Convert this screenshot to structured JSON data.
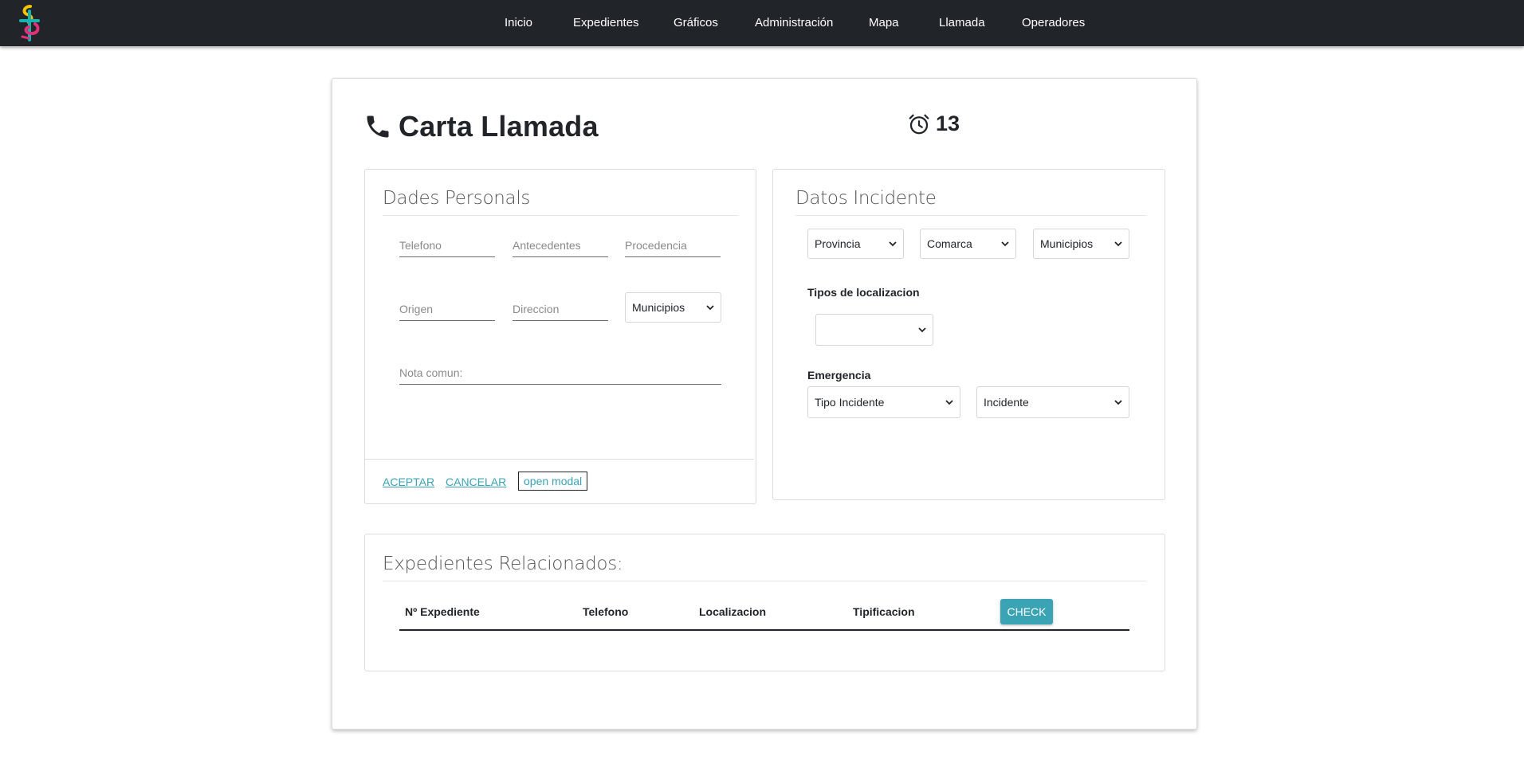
{
  "nav": {
    "items": [
      "Inicio",
      "Expedientes",
      "Gráficos",
      "Administración",
      "Mapa",
      "Llamada",
      "Operadores"
    ]
  },
  "header": {
    "title": "Carta Llamada",
    "timer_value": "13"
  },
  "personal": {
    "title": "Dades Personals",
    "telefono_placeholder": "Telefono",
    "antecedentes_placeholder": "Antecedentes",
    "procedencia_placeholder": "Procedencia",
    "origen_placeholder": "Origen",
    "direccion_placeholder": "Direccion",
    "municipios_select": "Municipios",
    "nota_placeholder": "Nota comun:",
    "aceptar_label": "ACEPTAR",
    "cancelar_label": "CANCELAR",
    "open_modal_label": "open modal"
  },
  "incidente": {
    "title": "Datos Incidente",
    "provincia_select": "Provincia",
    "comarca_select": "Comarca",
    "municipios_select": "Municipios",
    "tipos_localizacion_label": "Tipos de localizacion",
    "tipos_localizacion_select": "",
    "emergencia_label": "Emergencia",
    "tipo_incidente_select": "Tipo Incidente",
    "incidente_select": "Incidente"
  },
  "related": {
    "title": "Expedientes Relacionados:",
    "columns": [
      "Nº Expediente",
      "Telefono",
      "Localizacion",
      "Tipificacion"
    ],
    "check_label": "CHECK"
  },
  "colors": {
    "navbar": "#212529",
    "accent": "#3aa3b4"
  }
}
